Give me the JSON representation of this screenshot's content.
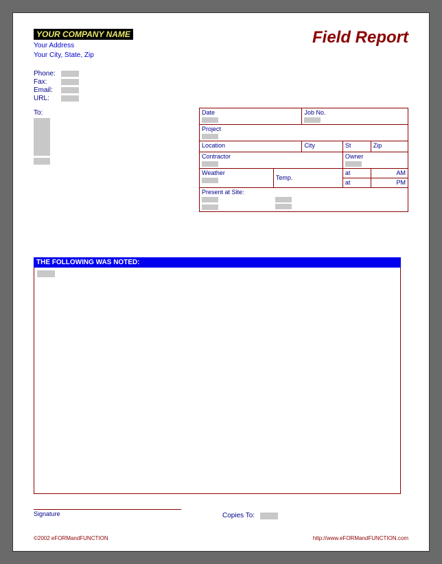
{
  "company": {
    "name": "YOUR COMPANY NAME",
    "address": "Your Address",
    "city_state_zip": "Your City, State, Zip"
  },
  "title": "Field Report",
  "contact": {
    "phone_label": "Phone:",
    "fax_label": "Fax:",
    "email_label": "Email:",
    "url_label": "URL:"
  },
  "to_label": "To:",
  "info": {
    "date": "Date",
    "jobno": "Job No.",
    "project": "Project",
    "location": "Location",
    "city": "City",
    "st": "St",
    "zip": "Zip",
    "contractor": "Contractor",
    "owner": "Owner",
    "weather": "Weather",
    "temp": "Temp.",
    "at1": "at",
    "at2": "at",
    "am": "AM",
    "pm": "PM",
    "present": "Present at Site:"
  },
  "notes_header": "THE FOLLOWING WAS NOTED:",
  "signature_label": "Signature",
  "copies_label": "Copies To:",
  "footer_left": "©2002 eFORMandFUNCTION",
  "footer_right": "http://www.eFORMandFUNCTION.com"
}
